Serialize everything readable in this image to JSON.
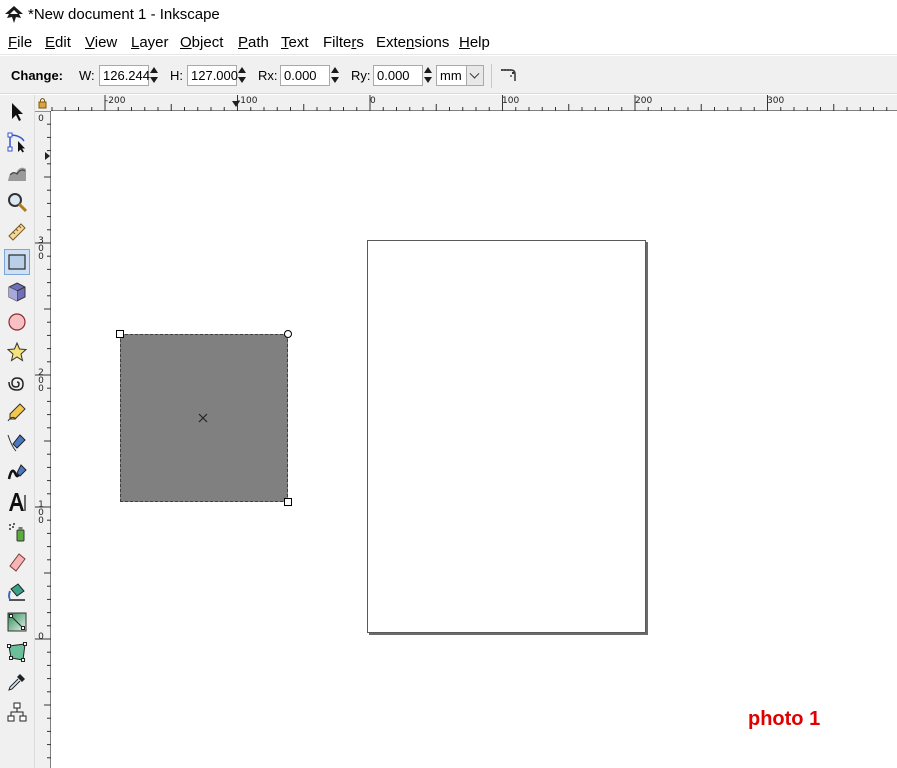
{
  "window": {
    "title": "*New document 1 - Inkscape",
    "icon": "inkscape-logo-icon"
  },
  "menu": [
    {
      "label": "File",
      "mnemonic": "F",
      "rest": "ile"
    },
    {
      "label": "Edit",
      "mnemonic": "E",
      "rest": "dit"
    },
    {
      "label": "View",
      "mnemonic": "V",
      "rest": "iew"
    },
    {
      "label": "Layer",
      "mnemonic": "L",
      "rest": "ayer"
    },
    {
      "label": "Object",
      "mnemonic": "O",
      "rest": "bject"
    },
    {
      "label": "Path",
      "mnemonic": "P",
      "rest": "ath"
    },
    {
      "label": "Text",
      "mnemonic": "T",
      "rest": "ext"
    },
    {
      "label": "Filters",
      "pre": "Filte",
      "mnemonic": "r",
      "rest": "s"
    },
    {
      "label": "Extensions",
      "pre": "Exte",
      "mnemonic": "n",
      "rest": "sions"
    },
    {
      "label": "Help",
      "mnemonic": "H",
      "rest": "elp"
    }
  ],
  "tool_controls": {
    "change_label": "Change:",
    "w_label": "W:",
    "w_value": "126.244",
    "h_label": "H:",
    "h_value": "127.000",
    "rx_label": "Rx:",
    "rx_value": "0.000",
    "ry_label": "Ry:",
    "ry_value": "0.000",
    "unit": "mm",
    "reset_icon": "reset-rounded-corners-icon"
  },
  "toolbox": [
    {
      "name": "selector-tool",
      "icon": "arrow-pointer-icon"
    },
    {
      "name": "node-tool",
      "icon": "node-edit-icon"
    },
    {
      "name": "tweak-tool",
      "icon": "tweak-wave-icon"
    },
    {
      "name": "zoom-tool",
      "icon": "magnifier-icon"
    },
    {
      "name": "measure-tool",
      "icon": "ruler-measure-icon"
    },
    {
      "name": "rectangle-tool",
      "icon": "rectangle-icon",
      "active": true
    },
    {
      "name": "3d-box-tool",
      "icon": "cube-icon"
    },
    {
      "name": "ellipse-tool",
      "icon": "circle-icon"
    },
    {
      "name": "star-tool",
      "icon": "star-icon"
    },
    {
      "name": "spiral-tool",
      "icon": "spiral-icon"
    },
    {
      "name": "pencil-tool",
      "icon": "pencil-icon"
    },
    {
      "name": "pen-tool",
      "icon": "pen-bezier-icon"
    },
    {
      "name": "calligraphy-tool",
      "icon": "calligraphy-icon"
    },
    {
      "name": "text-tool",
      "icon": "text-a-icon"
    },
    {
      "name": "spray-tool",
      "icon": "spray-can-icon"
    },
    {
      "name": "eraser-tool",
      "icon": "eraser-icon"
    },
    {
      "name": "paint-bucket-tool",
      "icon": "paint-bucket-icon"
    },
    {
      "name": "gradient-tool",
      "icon": "gradient-icon"
    },
    {
      "name": "mesh-tool",
      "icon": "mesh-icon"
    },
    {
      "name": "dropper-tool",
      "icon": "dropper-icon"
    },
    {
      "name": "connector-tool",
      "icon": "connector-icon"
    }
  ],
  "rulers": {
    "top_labels": [
      "-200",
      "-100",
      "0",
      "100",
      "200",
      "300"
    ],
    "left_labels": [
      "0",
      "300",
      "200",
      "100",
      "0"
    ]
  },
  "canvas": {
    "rect_color": "#808080",
    "selection": "rectangle"
  },
  "watermark": "photo 1"
}
